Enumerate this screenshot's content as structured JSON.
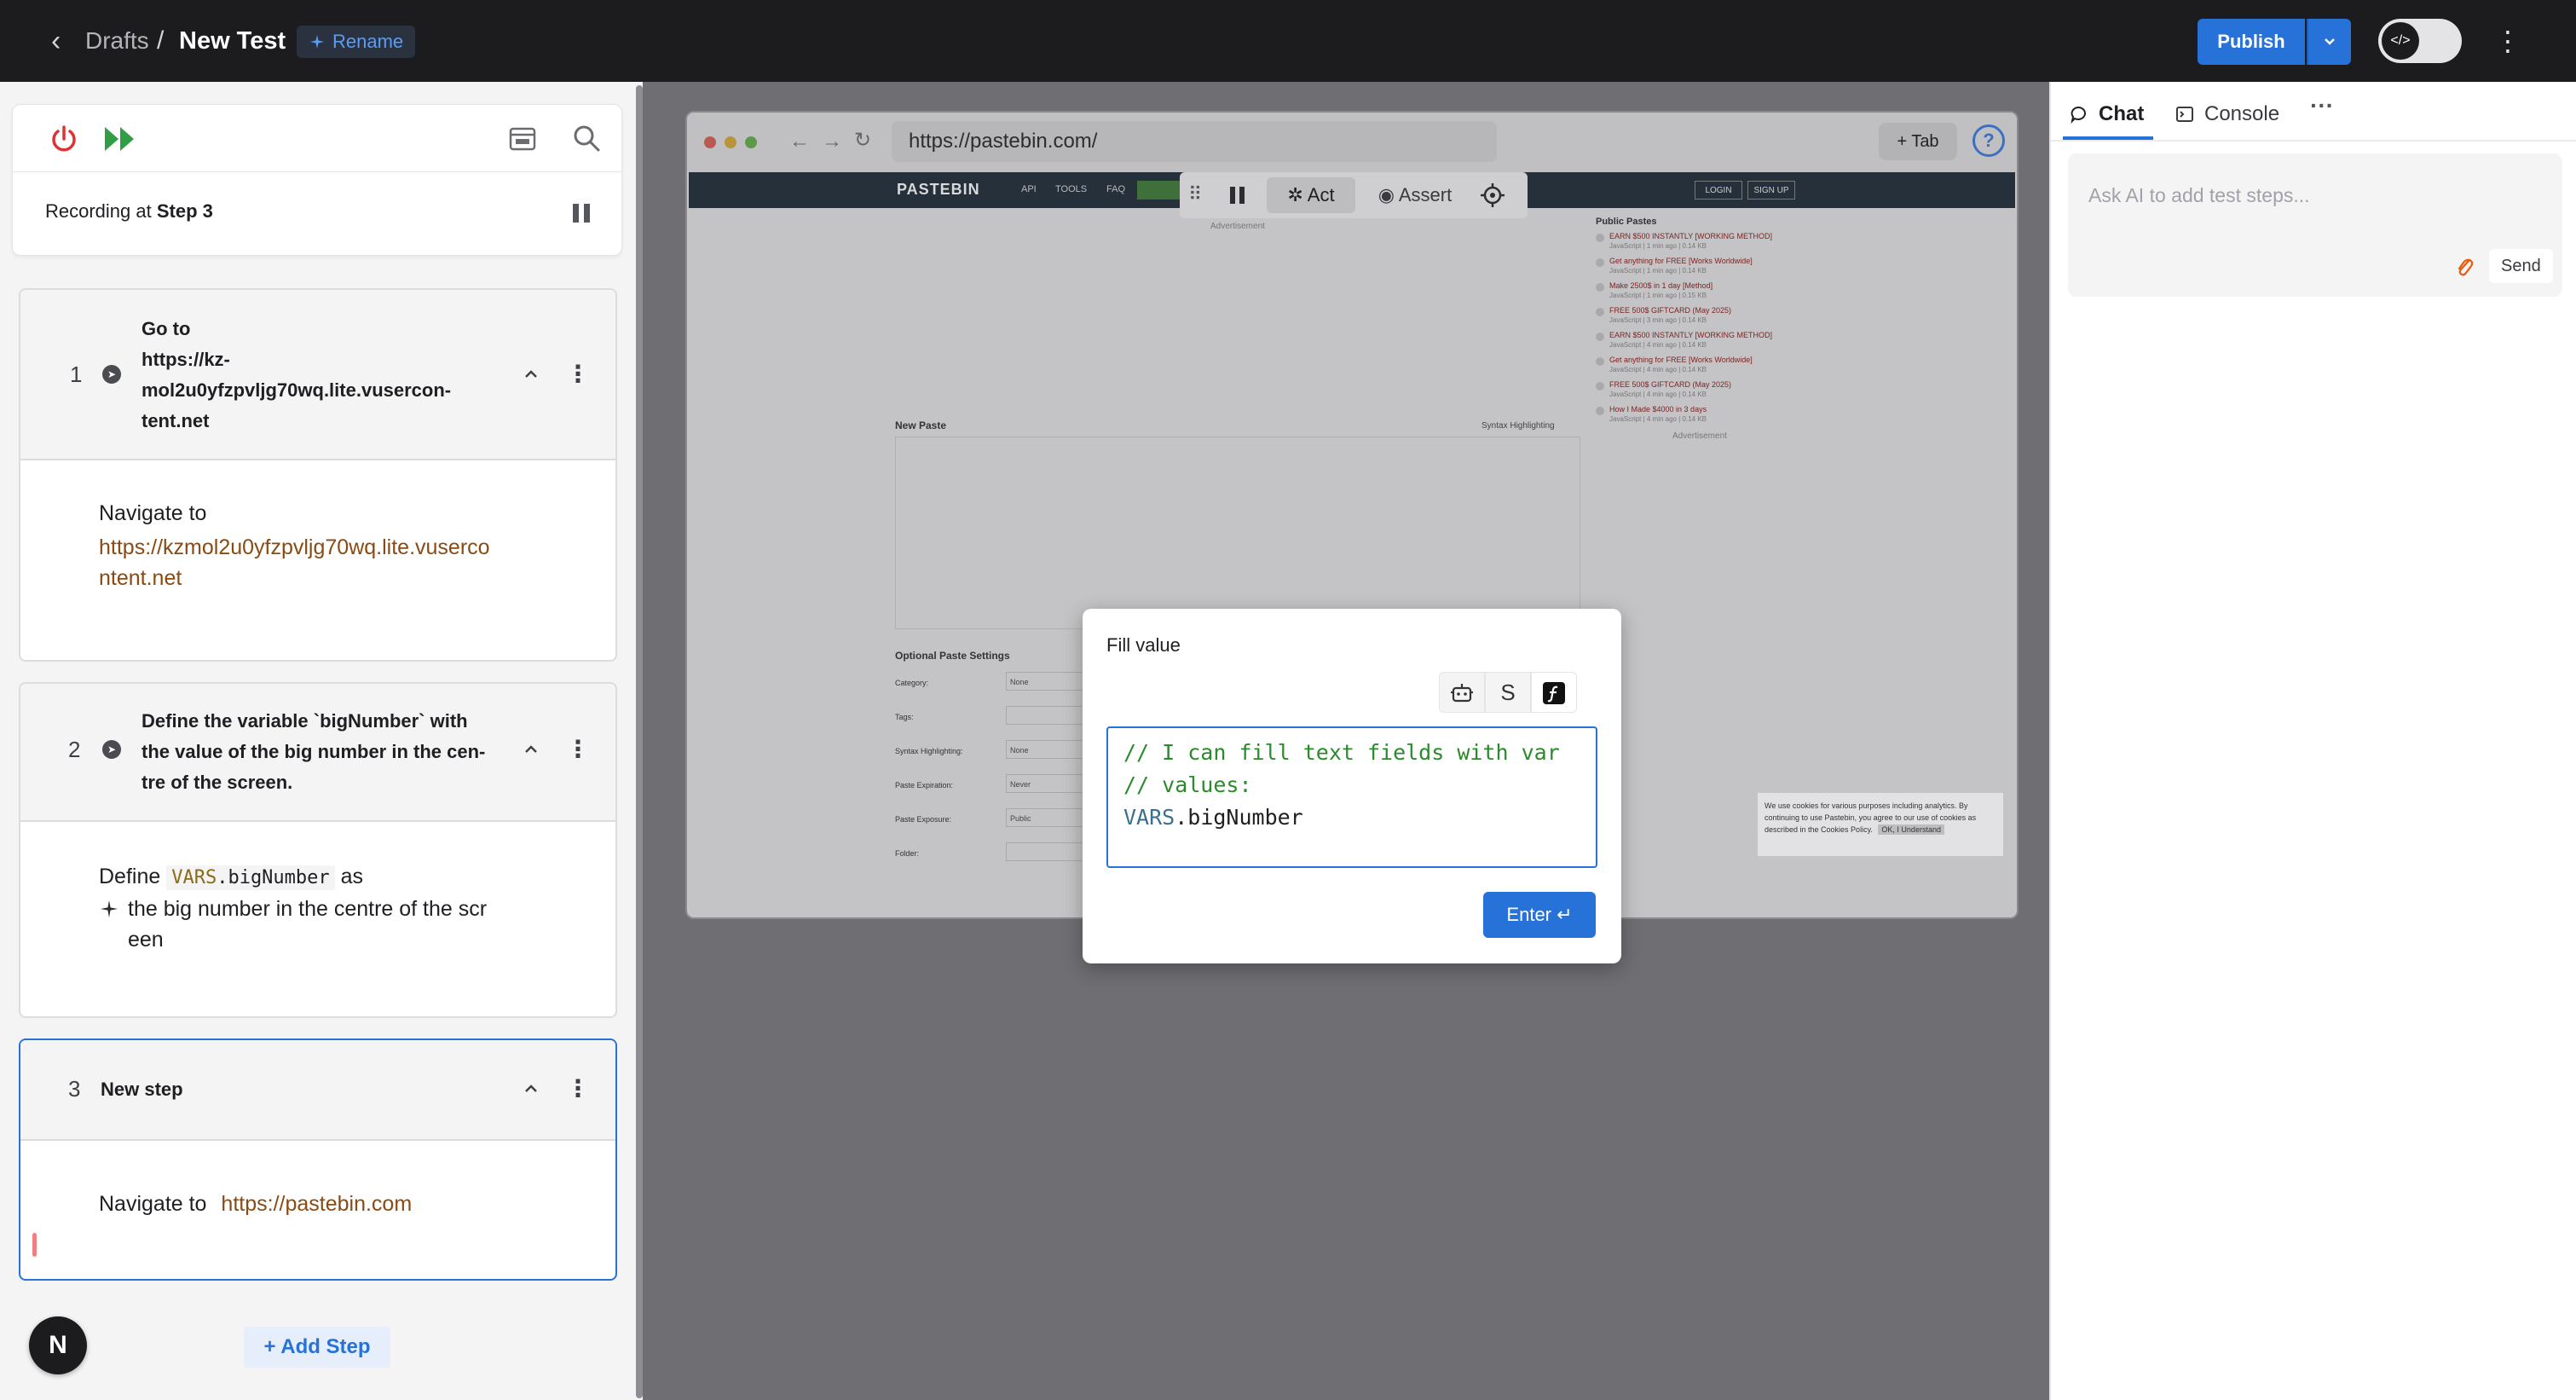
{
  "header": {
    "back_label": "‹",
    "breadcrumb_parent": "Drafts",
    "breadcrumb_sep": "/",
    "title": "New Test",
    "rename_label": "Rename",
    "publish_label": "Publish"
  },
  "recorder": {
    "recording_prefix": "Recording at ",
    "recording_step": "Step 3"
  },
  "steps": [
    {
      "number": "1",
      "title_lines": [
        "Go to",
        "https://kz-",
        "mol2u0yfzpvljg70wq.lite.vusercon-",
        "tent.net"
      ],
      "body_label": "Navigate to",
      "body_link_lines": [
        "https://kzmol2u0yfzpvljg70wq.lite.vuserco",
        "ntent.net"
      ]
    },
    {
      "number": "2",
      "title_lines": [
        "Define the variable `bigNumber` with",
        "the value of the big number in the cen-",
        "tre of the screen."
      ],
      "body_define": "Define",
      "body_vars": "VARS",
      "body_var_name": ".bigNumber",
      "body_as": "as",
      "body_desc_lines": [
        "the big number in the centre of the scr",
        "een"
      ]
    },
    {
      "number": "3",
      "title": "New step",
      "body_label": "Navigate to",
      "body_link": "https://pastebin.com"
    }
  ],
  "add_step_label": "+ Add Step",
  "avatar_letter": "N",
  "browser": {
    "url": "https://pastebin.com/",
    "tab_label": "+ Tab",
    "help_label": "?"
  },
  "site": {
    "logo": "PASTEBIN",
    "nav": [
      "API",
      "TOOLS",
      "FAQ"
    ],
    "login": "LOGIN",
    "signup": "SIGN UP",
    "advertisement": "Advertisement",
    "public_pastes_title": "Public Pastes",
    "public_pastes": [
      {
        "title": "EARN $500 INSTANTLY [WORKING METHOD]",
        "meta": "JavaScript | 1 min ago | 0.14 KB"
      },
      {
        "title": "Get anything for FREE [Works Worldwide]",
        "meta": "JavaScript | 1 min ago | 0.14 KB"
      },
      {
        "title": "Make 2500$ in 1 day [Method]",
        "meta": "JavaScript | 1 min ago | 0.15 KB"
      },
      {
        "title": "FREE 500$ GIFTCARD (May 2025)",
        "meta": "JavaScript | 3 min ago | 0.14 KB"
      },
      {
        "title": "EARN $500 INSTANTLY [WORKING METHOD]",
        "meta": "JavaScript | 4 min ago | 0.14 KB"
      },
      {
        "title": "Get anything for FREE [Works Worldwide]",
        "meta": "JavaScript | 4 min ago | 0.14 KB"
      },
      {
        "title": "FREE 500$ GIFTCARD (May 2025)",
        "meta": "JavaScript | 4 min ago | 0.14 KB"
      },
      {
        "title": "How I Made $4000 in 3 days",
        "meta": "JavaScript | 4 min ago | 0.14 KB"
      }
    ],
    "new_paste": "New Paste",
    "syntax_highlighting": "Syntax Highlighting",
    "optional_settings": "Optional Paste Settings",
    "options": [
      {
        "label": "Category:",
        "value": "None"
      },
      {
        "label": "Tags:",
        "value": ""
      },
      {
        "label": "Syntax Highlighting:",
        "value": "None"
      },
      {
        "label": "Paste Expiration:",
        "value": "Never"
      },
      {
        "label": "Paste Exposure:",
        "value": "Public"
      },
      {
        "label": "Folder:",
        "value": ""
      }
    ],
    "cookie_text": "We use cookies for various purposes including analytics. By continuing to use Pastebin, you agree to our use of cookies as described in the Cookies Policy.",
    "cookie_button": "OK, I Understand"
  },
  "rec_toolbar": {
    "act_label": "Act",
    "assert_label": "Assert"
  },
  "modal": {
    "title": "Fill value",
    "mode_labels": [
      "",
      "S",
      ""
    ],
    "code_comment_1": "// I can fill text fields with var",
    "code_comment_2": "// values:",
    "code_vars": "VARS",
    "code_rest": ".bigNumber",
    "enter_label": "Enter ↵"
  },
  "right": {
    "tab_chat": "Chat",
    "tab_console": "Console",
    "tab_more": "···",
    "chat_placeholder": "Ask AI to add test steps...",
    "send_label": "Send"
  },
  "colors": {
    "accent": "#2672d9",
    "link": "#8a4a13",
    "power": "#e03131",
    "play": "#2f9e44"
  }
}
